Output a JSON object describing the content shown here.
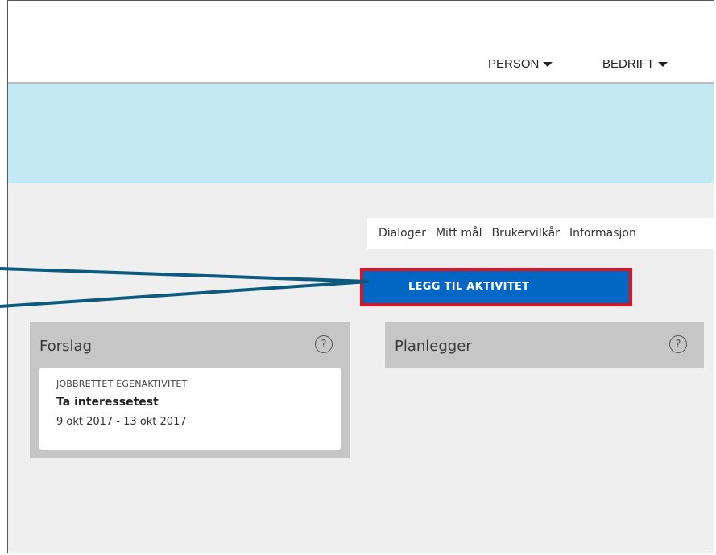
{
  "nav": {
    "items": [
      {
        "label": "PERSON"
      },
      {
        "label": "BEDRIFT"
      }
    ]
  },
  "subnav": {
    "items": [
      "Dialoger",
      "Mitt mål",
      "Brukervilkår",
      "Informasjon"
    ]
  },
  "actions": {
    "add_activity_label": "LEGG TIL AKTIVITET"
  },
  "columns": {
    "forslag": {
      "title": "Forslag",
      "help": "?",
      "cards": [
        {
          "type": "JOBBRETTET EGENAKTIVITET",
          "title": "Ta interessetest",
          "dates": "9 okt 2017 - 13 okt 2017"
        }
      ]
    },
    "planlegger": {
      "title": "Planlegger",
      "help": "?"
    }
  },
  "colors": {
    "banner": "#c5e8f5",
    "primary_button": "#0067c5",
    "highlight_border": "#e0121d",
    "annotation_arrow": "#0b5a80",
    "column_bg": "#c6c6c6"
  }
}
